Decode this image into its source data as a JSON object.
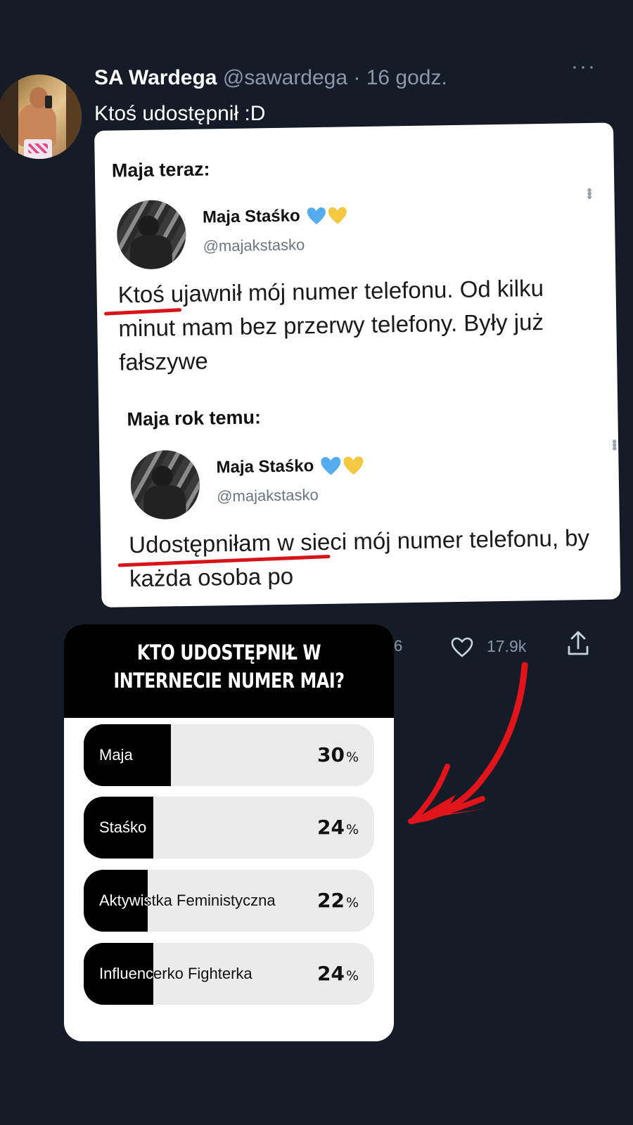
{
  "tweet": {
    "author_name": "SA Wardega",
    "author_handle": "@sawardega",
    "time": "· 16 godz.",
    "more": "···",
    "text": "Ktoś udostępnił :D"
  },
  "quoted": {
    "label_now": "Maja teraz:",
    "label_year": "Maja rok temu:",
    "post1": {
      "name": "Maja Staśko",
      "handle": "@majakstasko",
      "body": "Ktoś ujawnił mój numer telefonu. Od kilku minut mam bez przerwy telefony. Były już fałszywe"
    },
    "post2": {
      "name": "Maja Staśko",
      "handle": "@majakstasko",
      "body": "Udostępniłam w sieci mój numer telefonu, by każda osoba po"
    },
    "colors": {
      "heart_blue": "#55acee",
      "heart_yellow": "#f5c842",
      "underline": "#d7141a"
    }
  },
  "stats": {
    "partial_count": "6",
    "likes": "17.9k",
    "icons": [
      "heart-icon",
      "share-icon"
    ]
  },
  "poll": {
    "question": "KTO UDOSTĘPNIŁ W INTERNECIE NUMER MAI?",
    "options": [
      {
        "label": "Maja",
        "percent": "30",
        "fill": 0.3
      },
      {
        "label": "Staśko",
        "percent": "24",
        "fill": 0.24
      },
      {
        "label": "Aktywistka Feministyczna",
        "percent": "22",
        "fill": 0.22
      },
      {
        "label": "Influencerko Fighterka",
        "percent": "24",
        "fill": 0.24
      }
    ],
    "percent_sign": "%"
  },
  "arrow": {
    "color": "#e1141c"
  }
}
